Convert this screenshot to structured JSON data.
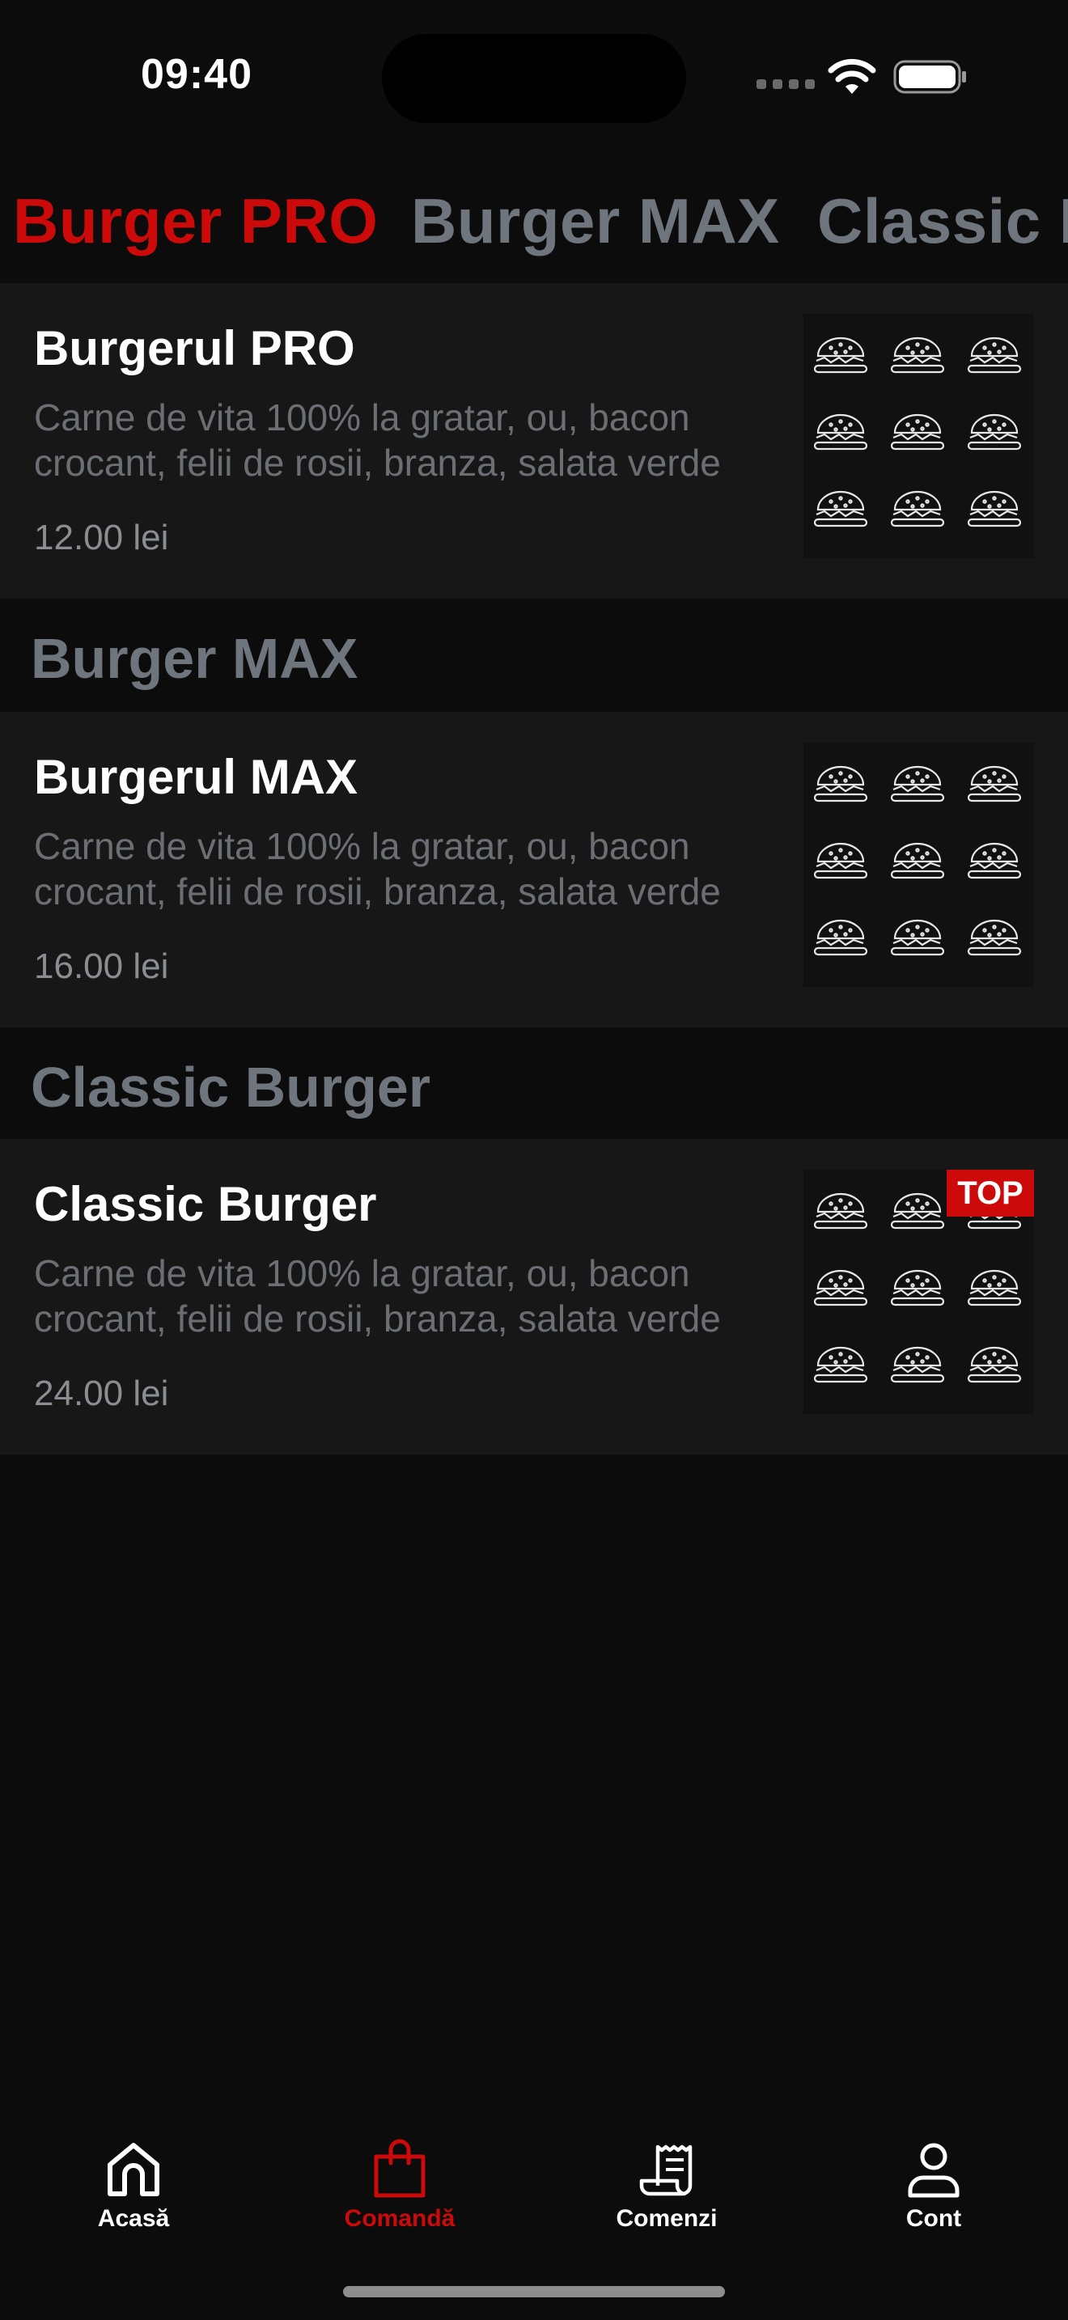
{
  "status_bar": {
    "time": "09:40",
    "icons": [
      "cellular-signal-icon",
      "wifi-icon",
      "battery-icon"
    ]
  },
  "tabs": [
    {
      "label": "Burger PRO",
      "active": true
    },
    {
      "label": "Burger MAX",
      "active": false
    },
    {
      "label": "Classic Burger",
      "active": false
    }
  ],
  "sections": [
    {
      "header": "",
      "product": {
        "title": "Burgerul PRO",
        "description": "Carne de vita 100% la gratar, ou, bacon crocant, felii de rosii, branza, salata verde",
        "price": "12.00 lei",
        "badge": ""
      }
    },
    {
      "header": "Burger MAX",
      "product": {
        "title": "Burgerul MAX",
        "description": "Carne de vita 100% la gratar, ou, bacon crocant, felii de rosii, branza, salata verde",
        "price": "16.00 lei",
        "badge": ""
      }
    },
    {
      "header": "Classic Burger",
      "product": {
        "title": "Classic Burger",
        "description": "Carne de vita 100% la gratar, ou, bacon crocant, felii de rosii, branza, salata verde",
        "price": "24.00 lei",
        "badge": "TOP"
      }
    }
  ],
  "bottom_nav": [
    {
      "label": "Acasă",
      "icon": "home-icon",
      "active": false
    },
    {
      "label": "Comandă",
      "icon": "shopping-bag-icon",
      "active": true
    },
    {
      "label": "Comenzi",
      "icon": "receipt-icon",
      "active": false
    },
    {
      "label": "Cont",
      "icon": "user-icon",
      "active": false
    }
  ],
  "colors": {
    "background": "#0c0c0c",
    "card": "#171717",
    "accent": "#cc0a0a",
    "muted_text": "#6f757c"
  }
}
